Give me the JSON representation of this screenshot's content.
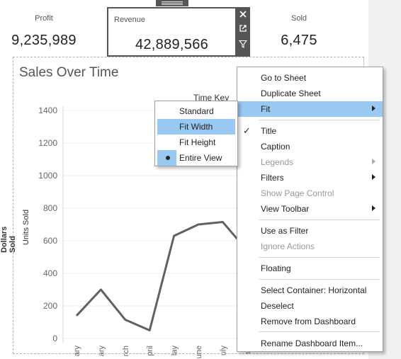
{
  "kpis": {
    "profit": {
      "label": "Profit",
      "value": "9,235,989"
    },
    "revenue": {
      "label": "Revenue",
      "value": "42,889,566"
    },
    "sold": {
      "label": "Sold",
      "value": "6,475"
    }
  },
  "toolbar": {
    "close_icon": "close-icon",
    "open_icon": "external-link-icon",
    "filter_icon": "filter-icon",
    "more_icon": "more-options-arrow-icon"
  },
  "worksheet": {
    "title": "Sales Over Time",
    "time_key_label": "Time Key",
    "left_axis_title": "Dollars Sold"
  },
  "chart_data": {
    "type": "line",
    "ylabel": "Units Sold",
    "ylim": [
      0,
      1400
    ],
    "yticks": [
      0,
      200,
      400,
      600,
      800,
      1000,
      1200,
      1400
    ],
    "categories": [
      "January",
      "February",
      "March",
      "April",
      "May",
      "June",
      "July",
      "August"
    ],
    "x_tick_labels": [
      "ary",
      "ary",
      "rch",
      "pril",
      "lay",
      "une",
      "uly",
      "us"
    ],
    "values": [
      140,
      300,
      115,
      50,
      630,
      700,
      715,
      540
    ],
    "line_color": "#616161",
    "grid": true
  },
  "context_menu": {
    "items": [
      {
        "label": "Go to Sheet",
        "accel": "G",
        "rest": "o to Sheet"
      },
      {
        "label": "Duplicate Sheet",
        "accel": "D",
        "rest": "uplicate Sheet"
      },
      {
        "label": "Fit",
        "accel": "F",
        "rest": "it",
        "submenu": true,
        "highlighted": true
      },
      {
        "label": "Title",
        "accel": "T",
        "rest": "itle",
        "checked": true
      },
      {
        "label": "Caption",
        "accel": "C",
        "rest": "aption"
      },
      {
        "label": "Legends",
        "submenu": true,
        "disabled": true
      },
      {
        "label": "Filters",
        "accel": "F",
        "rest": "ilters",
        "submenu": true
      },
      {
        "label": "Show Page Control",
        "disabled": true
      },
      {
        "label": "View Toolbar",
        "submenu": true
      },
      {
        "label": "Use as Filter",
        "accel": "U",
        "rest": "se as Filter"
      },
      {
        "label": "Ignore Actions",
        "disabled": true
      },
      {
        "label": "Floating"
      },
      {
        "label": "Select Container: Horizontal"
      },
      {
        "label": "Deselect"
      },
      {
        "label": "Remove from Dashboard"
      },
      {
        "label": "Rename Dashboard Item..."
      }
    ]
  },
  "fit_submenu": {
    "items": [
      {
        "label": "Standard"
      },
      {
        "label": "Fit Width",
        "highlighted": true
      },
      {
        "label": "Fit Height"
      },
      {
        "label": "Entire View",
        "selected": true
      }
    ]
  }
}
